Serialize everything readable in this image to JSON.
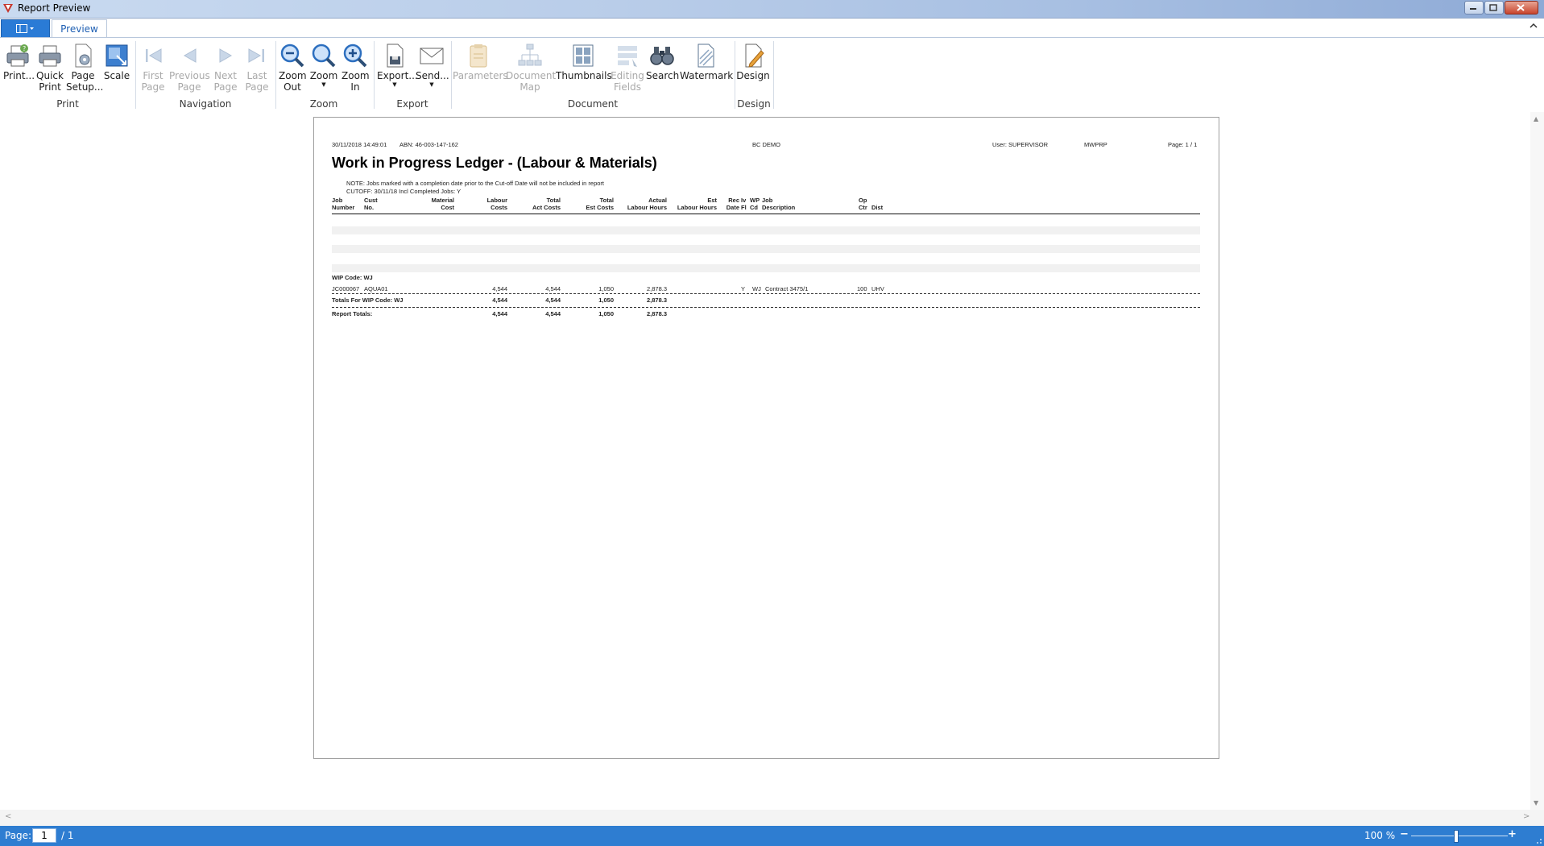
{
  "window": {
    "title": "Report Preview"
  },
  "ribbon": {
    "tab": "Preview",
    "groups": {
      "print": {
        "label": "Print",
        "print": "Print...",
        "quick_print": [
          "Quick",
          "Print"
        ],
        "page_setup": [
          "Page",
          "Setup..."
        ],
        "scale": "Scale"
      },
      "navigation": {
        "label": "Navigation",
        "first": [
          "First",
          "Page"
        ],
        "previous": [
          "Previous",
          "Page"
        ],
        "next": [
          "Next",
          "Page"
        ],
        "last": [
          "Last",
          "Page"
        ]
      },
      "zoom": {
        "label": "Zoom",
        "zoom_out": [
          "Zoom",
          "Out"
        ],
        "zoom": "Zoom",
        "zoom_in": [
          "Zoom",
          "In"
        ]
      },
      "export": {
        "label": "Export",
        "export": "Export...",
        "send": "Send..."
      },
      "document": {
        "label": "Document",
        "parameters": "Parameters",
        "document_map": [
          "Document",
          "Map"
        ],
        "thumbnails": "Thumbnails",
        "editing_fields": [
          "Editing",
          "Fields"
        ],
        "search": "Search",
        "watermark": "Watermark"
      },
      "design": {
        "label": "Design",
        "design": "Design"
      }
    }
  },
  "report": {
    "timestamp": "30/11/2018 14:49:01",
    "abn": "ABN: 46-003-147-162",
    "company": "BC DEMO",
    "user": "User: SUPERVISOR",
    "report_code": "MWPRP",
    "page": "Page: 1 / 1",
    "title": "Work in Progress Ledger - (Labour & Materials)",
    "note": "NOTE: Jobs marked with a completion date prior to the Cut-off Date will not be included in report",
    "cutoff": "CUTOFF:   30/11/18     Incl Completed Jobs:  Y",
    "columns": {
      "job": [
        "Job",
        "Number"
      ],
      "cust": [
        "Cust",
        "No."
      ],
      "material": [
        "Material",
        "Cost"
      ],
      "labour": [
        "Labour",
        "Costs"
      ],
      "total_act": [
        "Total",
        "Act Costs"
      ],
      "total_est": [
        "Total",
        "Est Costs"
      ],
      "actual_hours": [
        "Actual",
        "Labour Hours"
      ],
      "est_hours": [
        "Est",
        "Labour Hours"
      ],
      "rec_date": [
        "Rec",
        "Date"
      ],
      "iv": [
        "Iv",
        "Fl"
      ],
      "wp": [
        "WP",
        "Cd"
      ],
      "job_desc": [
        "Job",
        "Description"
      ],
      "op": [
        "Op",
        "Ctr"
      ],
      "dist": [
        "",
        "Dist"
      ]
    },
    "group_header": "WIP Code: WJ",
    "row": {
      "job": "JC000067",
      "cust": "AQUA01",
      "labour": "4,544",
      "total_act": "4,544",
      "total_est": "1,050",
      "actual_hours": "2,878.3",
      "iv": "Y",
      "wp": "WJ",
      "description": "Contract 3475/1",
      "op": "100",
      "dist": "UHV"
    },
    "group_totals": {
      "label": "Totals For WIP Code: WJ",
      "labour": "4,544",
      "total_act": "4,544",
      "total_est": "1,050",
      "actual_hours": "2,878.3"
    },
    "report_totals": {
      "label": "Report Totals:",
      "labour": "4,544",
      "total_act": "4,544",
      "total_est": "1,050",
      "actual_hours": "2,878.3"
    }
  },
  "status": {
    "page_label": "Page:",
    "page_value": "1",
    "page_total": "/ 1",
    "zoom": "100 %",
    "zoom_fraction": 0.47
  },
  "colors": {
    "accent": "#2e7dd1",
    "titlebar": "#b9cde9",
    "disabled_text": "#a9a9a9"
  }
}
